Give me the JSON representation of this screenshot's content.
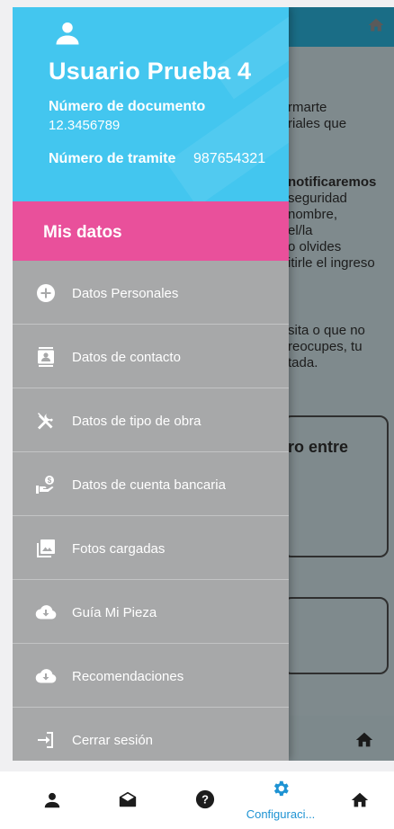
{
  "background": {
    "text_lines": [
      {
        "text": "rmarte",
        "bold": false
      },
      {
        "text": "riales que",
        "bold": false
      },
      {
        "text": "notificaremos",
        "bold": true
      },
      {
        "text": "seguridad",
        "bold": false
      },
      {
        "text": "nombre,",
        "bold": false
      },
      {
        "text": "el/la",
        "bold": false
      },
      {
        "text": "o olvides",
        "bold": false
      },
      {
        "text": "itirle el ingreso",
        "bold": false
      },
      {
        "text": "sita o que no",
        "bold": false
      },
      {
        "text": "reocupes, tu",
        "bold": false
      },
      {
        "text": "tada.",
        "bold": false
      },
      {
        "text": "ro entre",
        "bold": true
      }
    ]
  },
  "drawer": {
    "user_name": "Usuario Prueba 4",
    "document_label": "Número de documento",
    "document_value": "12.3456789",
    "tramite_label": "Número de tramite",
    "tramite_value": "987654321",
    "section_title": "Mis datos",
    "menu": [
      {
        "label": "Datos Personales",
        "icon": "plus-circle-icon"
      },
      {
        "label": "Datos de contacto",
        "icon": "contact-card-icon"
      },
      {
        "label": "Datos de tipo de obra",
        "icon": "tools-icon"
      },
      {
        "label": "Datos de cuenta bancaria",
        "icon": "money-hand-icon"
      },
      {
        "label": "Fotos cargadas",
        "icon": "photo-library-icon"
      },
      {
        "label": "Guía Mi Pieza",
        "icon": "cloud-download-icon"
      },
      {
        "label": "Recomendaciones",
        "icon": "cloud-download-icon"
      },
      {
        "label": "Cerrar sesión",
        "icon": "logout-icon"
      }
    ]
  },
  "bottom_nav": {
    "items": [
      {
        "icon": "person-icon",
        "active": false
      },
      {
        "icon": "envelope-open-icon",
        "active": false
      },
      {
        "icon": "help-circle-icon",
        "active": false
      },
      {
        "icon": "gear-icon",
        "active": true,
        "label": "Configuraci..."
      },
      {
        "icon": "home-icon",
        "active": false
      }
    ],
    "active_color": "#1e93d3"
  },
  "colors": {
    "header": "#43c6ef",
    "section": "#e9509b",
    "drawer": "#a7a8a9"
  }
}
